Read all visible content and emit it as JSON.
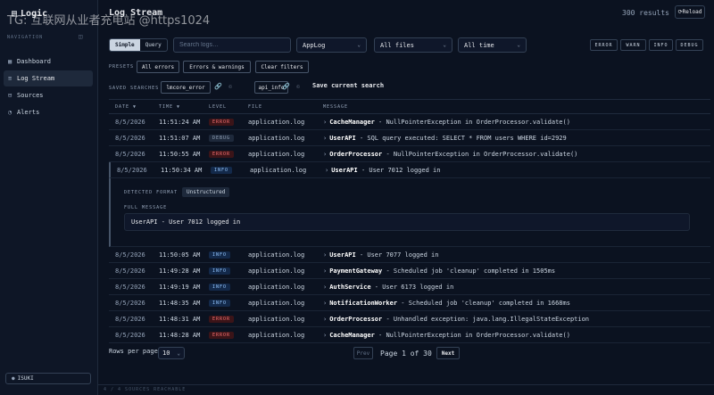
{
  "app": {
    "name": "Logic",
    "watermark": "TG: 互联网从业者充电站 @https1024"
  },
  "sidebar": {
    "section_label": "NAVIGATION",
    "items": [
      {
        "label": "Dashboard",
        "icon": "grid-icon"
      },
      {
        "label": "Log Stream",
        "icon": "list-icon",
        "active": true
      },
      {
        "label": "Sources",
        "icon": "database-icon"
      },
      {
        "label": "Alerts",
        "icon": "bell-icon"
      }
    ],
    "user": "ISUKI"
  },
  "footer": {
    "status": "4 / 4 SOURCES REACHABLE"
  },
  "header": {
    "title": "Log Stream",
    "results": "300 results",
    "reload_label": "⟳Reload"
  },
  "toolbar": {
    "modes": [
      "Simple",
      "Query"
    ],
    "active_mode": "Simple",
    "search_placeholder": "Search logs…",
    "source_select": "AppLog",
    "file_select": "All files",
    "time_select": "All time",
    "levels": [
      "ERROR",
      "WARN",
      "INFO",
      "DEBUG"
    ]
  },
  "presets": {
    "label": "PRESETS",
    "items": [
      "All errors",
      "Errors & warnings",
      "Clear filters"
    ]
  },
  "saved": {
    "label": "SAVED SEARCHES",
    "items": [
      "lmcore_error",
      "api_info"
    ],
    "save_label": "Save current search"
  },
  "table": {
    "columns": [
      "DATE ▼",
      "TIME ▼",
      "LEVEL",
      "FILE",
      "MESSAGE"
    ],
    "rows_before": [
      {
        "date": "8/5/2026",
        "time": "11:51:24 AM",
        "level": "ERROR",
        "file": "application.log",
        "source": "CacheManager",
        "text": " - NullPointerException in OrderProcessor.validate()"
      },
      {
        "date": "8/5/2026",
        "time": "11:51:07 AM",
        "level": "DEBUG",
        "file": "application.log",
        "source": "UserAPI",
        "text": " - SQL query executed: SELECT * FROM users WHERE id=2929"
      },
      {
        "date": "8/5/2026",
        "time": "11:50:55 AM",
        "level": "ERROR",
        "file": "application.log",
        "source": "OrderProcessor",
        "text": " - NullPointerException in OrderProcessor.validate()"
      }
    ],
    "selected_row": {
      "date": "8/5/2026",
      "time": "11:50:34 AM",
      "level": "INFO",
      "file": "application.log",
      "source": "UserAPI",
      "text": " - User 7012 logged in"
    },
    "detail": {
      "format_label": "DETECTED FORMAT",
      "format_value": "Unstructured",
      "full_label": "FULL MESSAGE",
      "full_message": "UserAPI - User 7012 logged in"
    },
    "rows_after": [
      {
        "date": "8/5/2026",
        "time": "11:50:05 AM",
        "level": "INFO",
        "file": "application.log",
        "source": "UserAPI",
        "text": " - User 7077 logged in"
      },
      {
        "date": "8/5/2026",
        "time": "11:49:28 AM",
        "level": "INFO",
        "file": "application.log",
        "source": "PaymentGateway",
        "text": " - Scheduled job 'cleanup' completed in 1505ms"
      },
      {
        "date": "8/5/2026",
        "time": "11:49:19 AM",
        "level": "INFO",
        "file": "application.log",
        "source": "AuthService",
        "text": " - User 6173 logged in"
      },
      {
        "date": "8/5/2026",
        "time": "11:48:35 AM",
        "level": "INFO",
        "file": "application.log",
        "source": "NotificationWorker",
        "text": " - Scheduled job 'cleanup' completed in 1668ms"
      },
      {
        "date": "8/5/2026",
        "time": "11:48:31 AM",
        "level": "ERROR",
        "file": "application.log",
        "source": "OrderProcessor",
        "text": " - Unhandled exception: java.lang.IllegalStateException"
      },
      {
        "date": "8/5/2026",
        "time": "11:48:28 AM",
        "level": "ERROR",
        "file": "application.log",
        "source": "CacheManager",
        "text": " - NullPointerException in OrderProcessor.validate()"
      }
    ]
  },
  "pagination": {
    "rows_per_page_label": "Rows per page",
    "rows_per_page": "10",
    "prev": "Prev",
    "page_info": "Page 1 of 30",
    "next": "Next"
  }
}
